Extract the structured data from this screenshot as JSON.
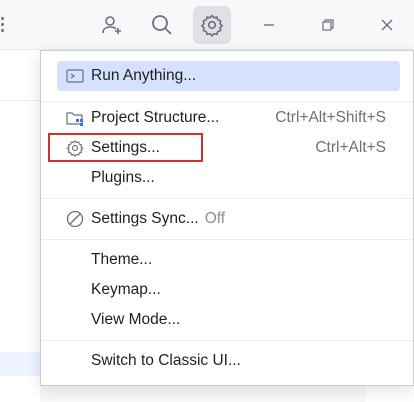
{
  "colors": {
    "highlight": "#d5e1ff",
    "focus_box": "#d32f2f",
    "shortcut_text": "#6c707e",
    "blue_accent": "#3574f0"
  },
  "titlebar": {
    "icons": [
      "more-vertical-icon",
      "add-user-icon",
      "search-icon",
      "gear-icon",
      "minimize-icon",
      "restore-icon",
      "close-icon"
    ]
  },
  "menu": {
    "items": [
      {
        "label": "Run Anything...",
        "icon": "run-anything-icon",
        "shortcut": ""
      },
      {
        "label": "Project Structure...",
        "icon": "project-structure-icon",
        "shortcut": "Ctrl+Alt+Shift+S"
      },
      {
        "label": "Settings...",
        "icon": "gear-icon",
        "shortcut": "Ctrl+Alt+S"
      },
      {
        "label": "Plugins...",
        "icon": "",
        "shortcut": ""
      },
      {
        "label": "Settings Sync...",
        "icon": "blocked-icon",
        "shortcut": "",
        "status": "Off"
      },
      {
        "label": "Theme...",
        "icon": "",
        "shortcut": ""
      },
      {
        "label": "Keymap...",
        "icon": "",
        "shortcut": ""
      },
      {
        "label": "View Mode...",
        "icon": "",
        "shortcut": ""
      },
      {
        "label": "Switch to Classic UI...",
        "icon": "",
        "shortcut": ""
      }
    ]
  }
}
